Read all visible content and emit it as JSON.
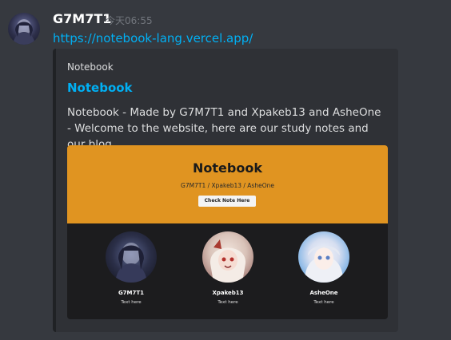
{
  "message": {
    "username": "G7M7T1",
    "timestamp": "今天06:55",
    "link": "https://notebook-lang.vercel.app/",
    "avatar_icon": "user-avatar"
  },
  "embed": {
    "provider": "Notebook",
    "title": "Notebook",
    "description": "Notebook - Made by G7M7T1 and Xpakeb13 and AsheOne - Welcome to the website, here are our study notes and our blog",
    "border_color": "#202225",
    "link_color": "#00b0f4",
    "image": {
      "hero_title": "Notebook",
      "hero_subtitle": "G7M7T1 / Xpakeb13 / AsheOne",
      "button_label": "Check Note Here",
      "hero_color": "#e09421",
      "members": [
        {
          "name": "G7M7T1",
          "text": "Text here"
        },
        {
          "name": "Xpakeb13",
          "text": "Text here"
        },
        {
          "name": "AsheOne",
          "text": "Text here"
        }
      ]
    }
  }
}
